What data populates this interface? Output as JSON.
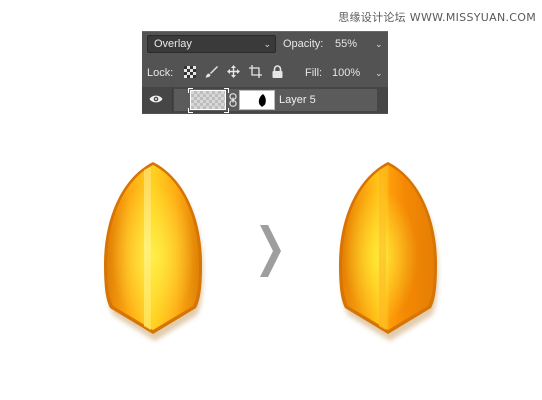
{
  "watermark": "思缘设计论坛  WWW.MISSYUAN.COM",
  "panel": {
    "blend_mode": "Overlay",
    "opacity_label": "Opacity:",
    "opacity_value": "55%",
    "lock_label": "Lock:",
    "fill_label": "Fill:",
    "fill_value": "100%",
    "layer_name": "Layer 5",
    "lock_icons": [
      "transparency-lock-icon",
      "brush-lock-icon",
      "move-lock-icon",
      "artboard-lock-icon",
      "padlock-icon"
    ]
  },
  "colors": {
    "panel_bg": "#535353",
    "shape_orange": "#f59a0a",
    "shape_yellow": "#ffd21e",
    "highlight": "#ffe96a",
    "arrow_gray": "#9e9e9e"
  }
}
